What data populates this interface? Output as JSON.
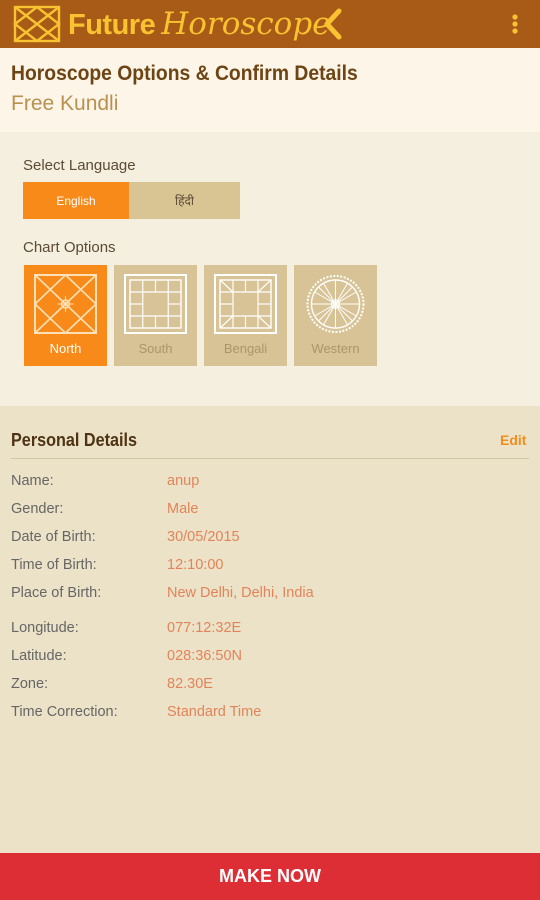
{
  "header": {
    "brand_first": "Future",
    "brand_second": "Horoscope"
  },
  "titlebar": {
    "title": "Horoscope Options & Confirm Details",
    "subtitle": "Free Kundli"
  },
  "options": {
    "language_label": "Select Language",
    "languages": [
      {
        "label": "English",
        "selected": true
      },
      {
        "label": "हिंदी",
        "selected": false
      }
    ],
    "chart_label": "Chart Options",
    "charts": [
      {
        "label": "North",
        "icon": "north-chart-icon",
        "selected": true
      },
      {
        "label": "South",
        "icon": "south-chart-icon",
        "selected": false
      },
      {
        "label": "Bengali",
        "icon": "bengali-chart-icon",
        "selected": false
      },
      {
        "label": "Western",
        "icon": "western-chart-icon",
        "selected": false
      }
    ]
  },
  "personal": {
    "title": "Personal Details",
    "edit_label": "Edit",
    "fields": [
      {
        "label": "Name:",
        "value": "anup"
      },
      {
        "label": "Gender:",
        "value": "Male"
      },
      {
        "label": "Date of Birth:",
        "value": "30/05/2015"
      },
      {
        "label": "Time of Birth:",
        "value": "12:10:00"
      },
      {
        "label": "Place of Birth:",
        "value": "New Delhi, Delhi, India"
      },
      {
        "label": "Longitude:",
        "value": "077:12:32E"
      },
      {
        "label": "Latitude:",
        "value": "028:36:50N"
      },
      {
        "label": "Zone:",
        "value": "82.30E"
      },
      {
        "label": "Time Correction:",
        "value": "Standard Time"
      }
    ]
  },
  "footer": {
    "action_label": "MAKE NOW"
  },
  "colors": {
    "topbar": "#a85a17",
    "brand": "#f9c230",
    "accent_orange": "#f88a1a",
    "value_text": "#e2845a",
    "action_red": "#dc2e34"
  }
}
